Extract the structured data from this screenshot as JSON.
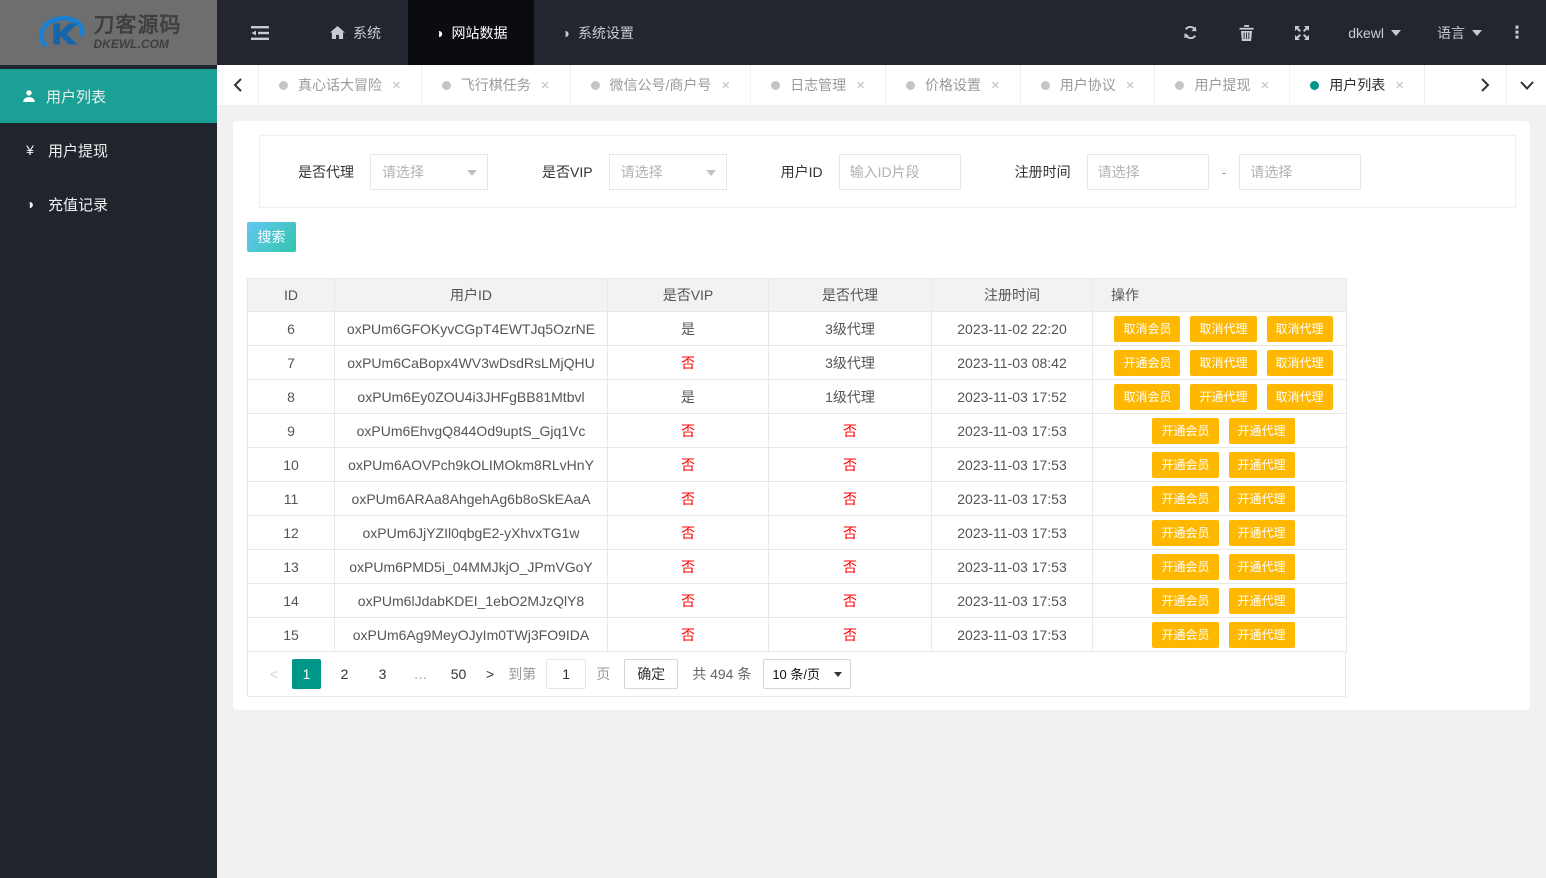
{
  "header": {
    "logo": {
      "brand": "刀客源码",
      "domain": "DKEWL.COM"
    },
    "nav": [
      {
        "id": "system",
        "label": "系统",
        "icon": "home",
        "active": false
      },
      {
        "id": "site-data",
        "label": "网站数据",
        "icon": "half-circle",
        "active": true
      },
      {
        "id": "system-settings",
        "label": "系统设置",
        "icon": "half-circle",
        "active": false
      }
    ],
    "user_dropdown": "dkewl",
    "language_dropdown": "语言"
  },
  "tabs": [
    {
      "id": "truth-or-dare",
      "label": "真心话大冒险",
      "active": false
    },
    {
      "id": "flight-chess-task",
      "label": "飞行棋任务",
      "active": false
    },
    {
      "id": "wechat-merchant",
      "label": "微信公号/商户号",
      "active": false
    },
    {
      "id": "log-manage",
      "label": "日志管理",
      "active": false
    },
    {
      "id": "price-setting",
      "label": "价格设置",
      "active": false
    },
    {
      "id": "user-agreement",
      "label": "用户协议",
      "active": false
    },
    {
      "id": "user-withdraw",
      "label": "用户提现",
      "active": false
    },
    {
      "id": "user-list",
      "label": "用户列表",
      "active": true
    }
  ],
  "sidebar": [
    {
      "id": "user-list",
      "label": "用户列表",
      "icon": "user",
      "active": true
    },
    {
      "id": "user-withdraw",
      "label": "用户提现",
      "icon": "yen",
      "active": false
    },
    {
      "id": "recharge-records",
      "label": "充值记录",
      "icon": "half-circle",
      "active": false
    }
  ],
  "filters": {
    "agent_label": "是否代理",
    "agent_placeholder": "请选择",
    "vip_label": "是否VIP",
    "vip_placeholder": "请选择",
    "user_id_label": "用户ID",
    "user_id_placeholder": "输入ID片段",
    "reg_time_label": "注册时间",
    "reg_start_placeholder": "请选择",
    "reg_end_placeholder": "请选择",
    "range_separator": "-"
  },
  "search_button": "搜索",
  "table": {
    "columns": [
      "ID",
      "用户ID",
      "是否VIP",
      "是否代理",
      "注册时间",
      "操作"
    ],
    "rows": [
      {
        "id": "6",
        "user_id": "oxPUm6GFOKyvCGpT4EWTJq5OzrNE",
        "vip": {
          "text": "是",
          "red": false
        },
        "agent": {
          "text": "3级代理",
          "red": false
        },
        "time": "2023-11-02 22:20",
        "actions": [
          "取消会员",
          "取消代理",
          "取消代理"
        ]
      },
      {
        "id": "7",
        "user_id": "oxPUm6CaBopx4WV3wDsdRsLMjQHU",
        "vip": {
          "text": "否",
          "red": true
        },
        "agent": {
          "text": "3级代理",
          "red": false
        },
        "time": "2023-11-03 08:42",
        "actions": [
          "开通会员",
          "取消代理",
          "取消代理"
        ]
      },
      {
        "id": "8",
        "user_id": "oxPUm6Ey0ZOU4i3JHFgBB81Mtbvl",
        "vip": {
          "text": "是",
          "red": false
        },
        "agent": {
          "text": "1级代理",
          "red": false
        },
        "time": "2023-11-03 17:52",
        "actions": [
          "取消会员",
          "开通代理",
          "取消代理"
        ]
      },
      {
        "id": "9",
        "user_id": "oxPUm6EhvgQ844Od9uptS_Gjq1Vc",
        "vip": {
          "text": "否",
          "red": true
        },
        "agent": {
          "text": "否",
          "red": true
        },
        "time": "2023-11-03 17:53",
        "actions": [
          "开通会员",
          "开通代理"
        ]
      },
      {
        "id": "10",
        "user_id": "oxPUm6AOVPch9kOLIMOkm8RLvHnY",
        "vip": {
          "text": "否",
          "red": true
        },
        "agent": {
          "text": "否",
          "red": true
        },
        "time": "2023-11-03 17:53",
        "actions": [
          "开通会员",
          "开通代理"
        ]
      },
      {
        "id": "11",
        "user_id": "oxPUm6ARAa8AhgehAg6b8oSkEAaA",
        "vip": {
          "text": "否",
          "red": true
        },
        "agent": {
          "text": "否",
          "red": true
        },
        "time": "2023-11-03 17:53",
        "actions": [
          "开通会员",
          "开通代理"
        ]
      },
      {
        "id": "12",
        "user_id": "oxPUm6JjYZIl0qbgE2-yXhvxTG1w",
        "vip": {
          "text": "否",
          "red": true
        },
        "agent": {
          "text": "否",
          "red": true
        },
        "time": "2023-11-03 17:53",
        "actions": [
          "开通会员",
          "开通代理"
        ]
      },
      {
        "id": "13",
        "user_id": "oxPUm6PMD5i_04MMJkjO_JPmVGoY",
        "vip": {
          "text": "否",
          "red": true
        },
        "agent": {
          "text": "否",
          "red": true
        },
        "time": "2023-11-03 17:53",
        "actions": [
          "开通会员",
          "开通代理"
        ]
      },
      {
        "id": "14",
        "user_id": "oxPUm6lJdabKDEI_1ebO2MJzQlY8",
        "vip": {
          "text": "否",
          "red": true
        },
        "agent": {
          "text": "否",
          "red": true
        },
        "time": "2023-11-03 17:53",
        "actions": [
          "开通会员",
          "开通代理"
        ]
      },
      {
        "id": "15",
        "user_id": "oxPUm6Ag9MeyOJyIm0TWj3FO9IDA",
        "vip": {
          "text": "否",
          "red": true
        },
        "agent": {
          "text": "否",
          "red": true
        },
        "time": "2023-11-03 17:53",
        "actions": [
          "开通会员",
          "开通代理"
        ]
      }
    ]
  },
  "pagination": {
    "prev": "<",
    "next": ">",
    "pages": [
      {
        "text": "1",
        "active": true,
        "ellipsis": false
      },
      {
        "text": "2",
        "active": false,
        "ellipsis": false
      },
      {
        "text": "3",
        "active": false,
        "ellipsis": false
      },
      {
        "text": "…",
        "active": false,
        "ellipsis": true
      },
      {
        "text": "50",
        "active": false,
        "ellipsis": false
      }
    ],
    "goto_label": "到第",
    "goto_value": "1",
    "unit_label": "页",
    "confirm_label": "确定",
    "total_label": "共 494 条",
    "page_size": "10 条/页"
  },
  "icons": {
    "half_circle": "◑",
    "yen": "¥",
    "close": "×",
    "kebab": "⋮"
  },
  "colors": {
    "teal_active": "#1aa094",
    "accent": "#009688",
    "warning_button": "#ffb800",
    "danger_text": "#ff0000",
    "header_dark": "#23262f",
    "sidebar_dark": "#20242c"
  }
}
